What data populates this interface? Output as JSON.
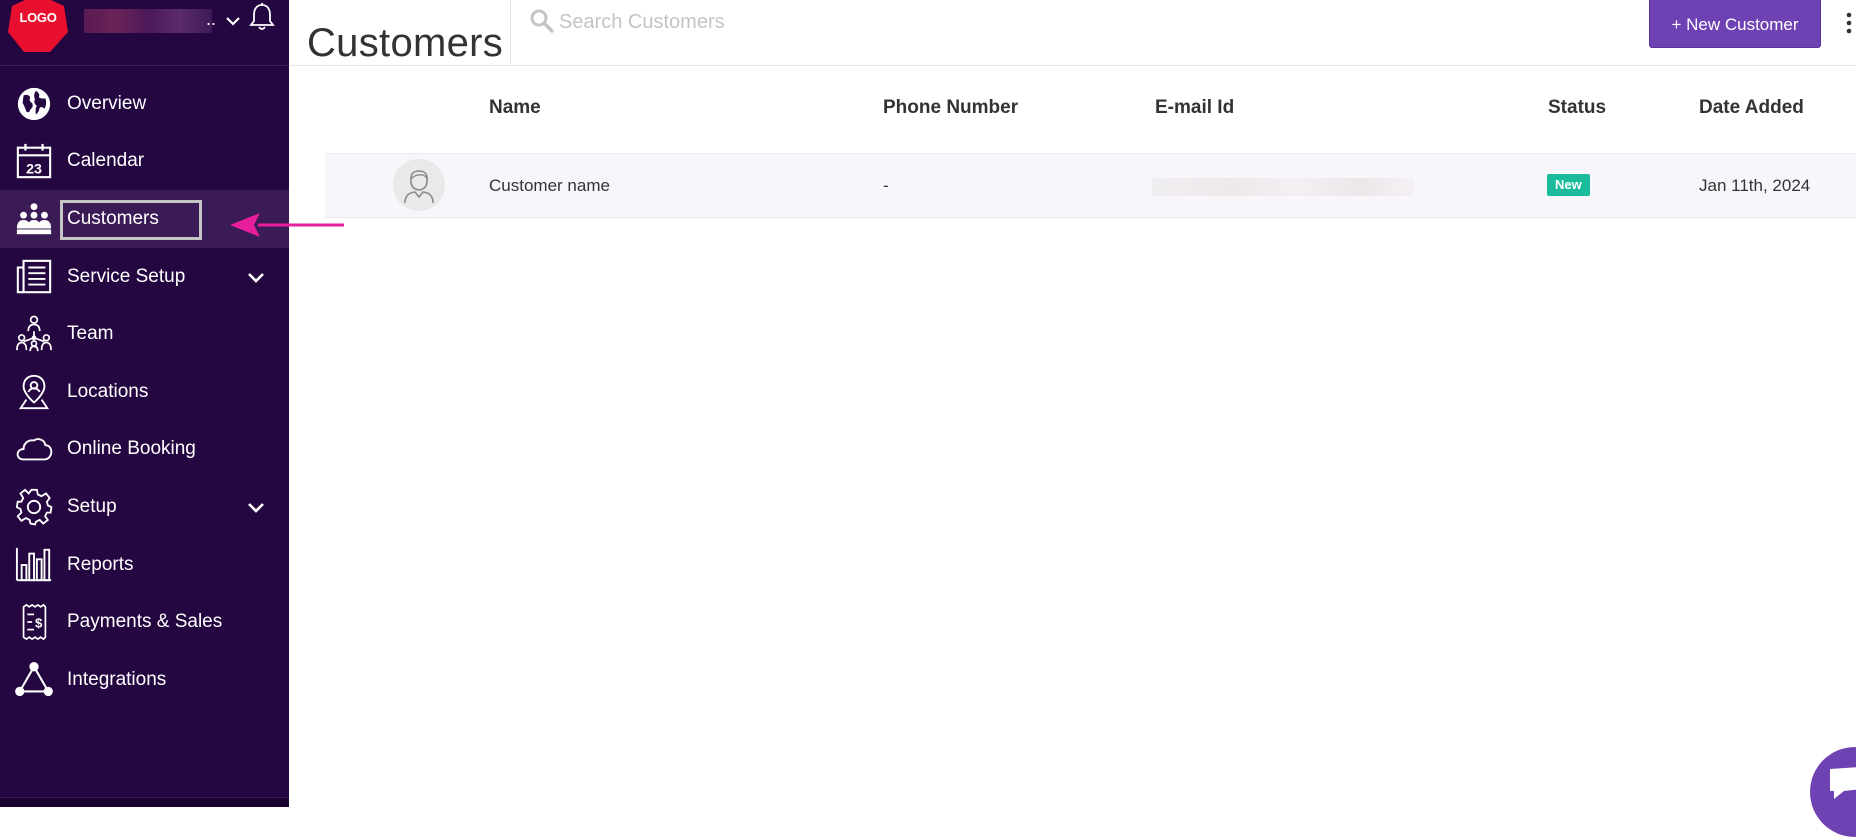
{
  "sidebar": {
    "logo_text": "LOGO",
    "account_name_suffix": "..",
    "items": [
      {
        "label": "Overview",
        "icon": "globe-icon",
        "active": false,
        "has_chevron": false
      },
      {
        "label": "Calendar",
        "icon": "calendar-icon",
        "calendar_day": "23",
        "active": false,
        "has_chevron": false
      },
      {
        "label": "Customers",
        "icon": "customers-icon",
        "active": true,
        "has_chevron": false
      },
      {
        "label": "Service Setup",
        "icon": "service-setup-icon",
        "active": false,
        "has_chevron": true
      },
      {
        "label": "Team",
        "icon": "team-icon",
        "active": false,
        "has_chevron": false
      },
      {
        "label": "Locations",
        "icon": "location-pin-icon",
        "active": false,
        "has_chevron": false
      },
      {
        "label": "Online Booking",
        "icon": "cloud-icon",
        "active": false,
        "has_chevron": false
      },
      {
        "label": "Setup",
        "icon": "gear-icon",
        "active": false,
        "has_chevron": true
      },
      {
        "label": "Reports",
        "icon": "bar-chart-icon",
        "active": false,
        "has_chevron": false
      },
      {
        "label": "Payments & Sales",
        "icon": "receipt-dollar-icon",
        "active": false,
        "has_chevron": false
      },
      {
        "label": "Integrations",
        "icon": "integrations-icon",
        "active": false,
        "has_chevron": false
      }
    ]
  },
  "header": {
    "title": "Customers",
    "search_placeholder": "Search Customers",
    "new_button_label": "+ New Customer"
  },
  "table": {
    "columns": [
      "Name",
      "Phone Number",
      "E-mail Id",
      "Status",
      "Date Added"
    ],
    "rows": [
      {
        "name": "Customer name",
        "phone": "-",
        "email": "",
        "status": "New",
        "date_added": "Jan 11th, 2024"
      }
    ]
  },
  "colors": {
    "sidebar_bg": "#240640",
    "sidebar_active_bg": "#3a1b55",
    "primary_button": "#6f42b3",
    "status_new": "#1abc9c",
    "annotation_arrow": "#e91e9b",
    "logo_red": "#e8102e"
  }
}
